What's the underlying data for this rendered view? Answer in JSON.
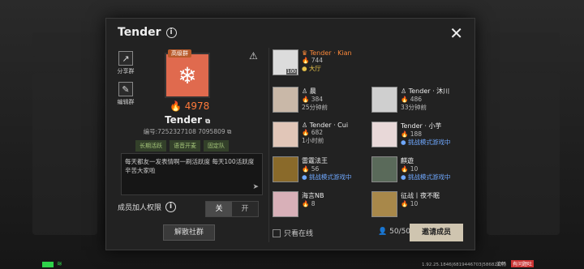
{
  "dialog": {
    "title": "Tender",
    "close_icon": "close-icon"
  },
  "tools": [
    {
      "label": "分享群",
      "icon": "share-icon"
    },
    {
      "label": "编辑群",
      "icon": "edit-icon"
    }
  ],
  "club": {
    "badge": "高级群",
    "score": "4978",
    "name": "Tender",
    "id": "编号:7252327108 7095809",
    "tags": [
      "长期活跃",
      "语音开麦",
      "固定队"
    ],
    "description": "每天都友一发表情啊一刷活跃度 每天100活跃度 辛苦大家啦",
    "permission_label": "成员加人权限",
    "toggle_off": "关",
    "toggle_on": "开",
    "disband_label": "解散社群"
  },
  "members": [
    {
      "name": "Tender · Kian",
      "score": "744",
      "status": "大厅",
      "level": "100",
      "leader": true
    },
    {
      "name": "晨",
      "score": "384",
      "status": "25分钟前",
      "level": "",
      "leader": false
    },
    {
      "name": "Tender · 沐川",
      "score": "486",
      "status": "33分钟前",
      "level": "",
      "leader": false
    },
    {
      "name": "Tender · Cui",
      "score": "682",
      "status": "1小时前",
      "level": "",
      "leader": false
    },
    {
      "name": "Tender · 小芋",
      "score": "188",
      "status": "挑战模式游戏中",
      "level": "",
      "leader": false
    },
    {
      "name": "雷霆法王",
      "score": "56",
      "status": "挑战模式游戏中",
      "level": "",
      "leader": false
    },
    {
      "name": "麒遊",
      "score": "10",
      "status": "挑战模式游戏中",
      "level": "",
      "leader": false
    },
    {
      "name": "海言NB",
      "score": "8",
      "status": "",
      "level": "",
      "leader": false
    },
    {
      "name": "征战丨夜不眠",
      "score": "10",
      "status": "",
      "level": "",
      "leader": false
    }
  ],
  "footer": {
    "online_only_label": "只看在线",
    "member_count": "50/50",
    "invite_label": "邀请成员"
  },
  "statusbar": {
    "version": "1.92.25.1846|6819446703|5868217",
    "flow": "流畅",
    "report": "有问题吐"
  },
  "colors": {
    "accent": "#ff7a3a",
    "emblem": "#e06a4e",
    "invite_bg": "#cfc5b0"
  }
}
